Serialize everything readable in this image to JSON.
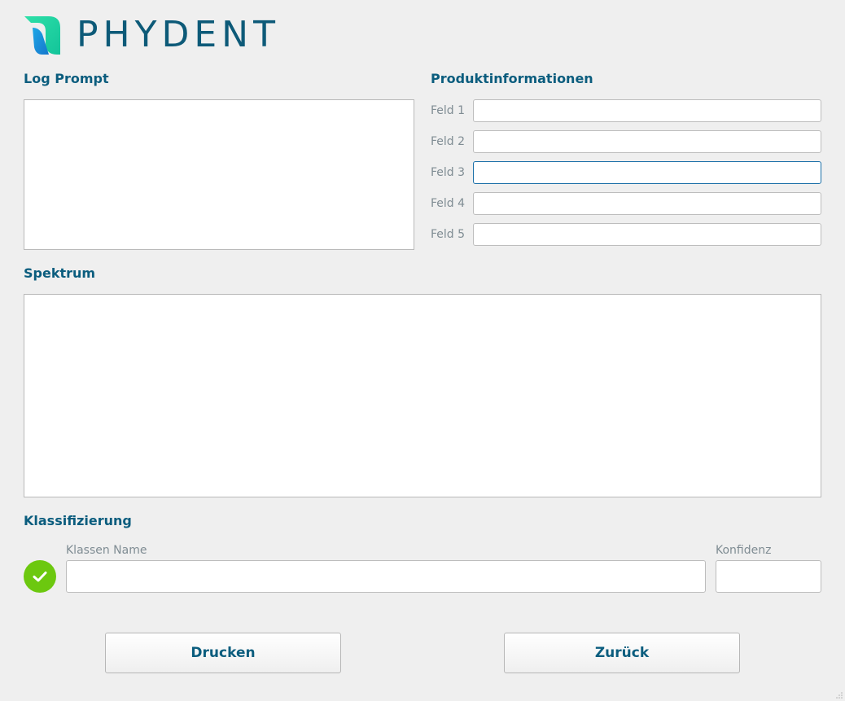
{
  "brand": {
    "name": "PHYDENT",
    "colors": {
      "primary": "#0d5a78",
      "accent_green": "#1fd6a0",
      "accent_blue": "#1b8fe0",
      "success": "#6cc80f"
    }
  },
  "log_prompt": {
    "title": "Log Prompt",
    "content": ""
  },
  "product_info": {
    "title": "Produktinformationen",
    "fields": [
      {
        "label": "Feld 1",
        "value": ""
      },
      {
        "label": "Feld 2",
        "value": ""
      },
      {
        "label": "Feld 3",
        "value": ""
      },
      {
        "label": "Feld 4",
        "value": ""
      },
      {
        "label": "Feld 5",
        "value": ""
      }
    ],
    "focused_field": "Feld 3"
  },
  "spectrum": {
    "title": "Spektrum"
  },
  "classification": {
    "title": "Klassifizierung",
    "status_icon": "check-icon",
    "class_name_label": "Klassen Name",
    "class_name_value": "",
    "confidence_label": "Konfidenz",
    "confidence_value": ""
  },
  "actions": {
    "print_label": "Drucken",
    "back_label": "Zurück"
  }
}
